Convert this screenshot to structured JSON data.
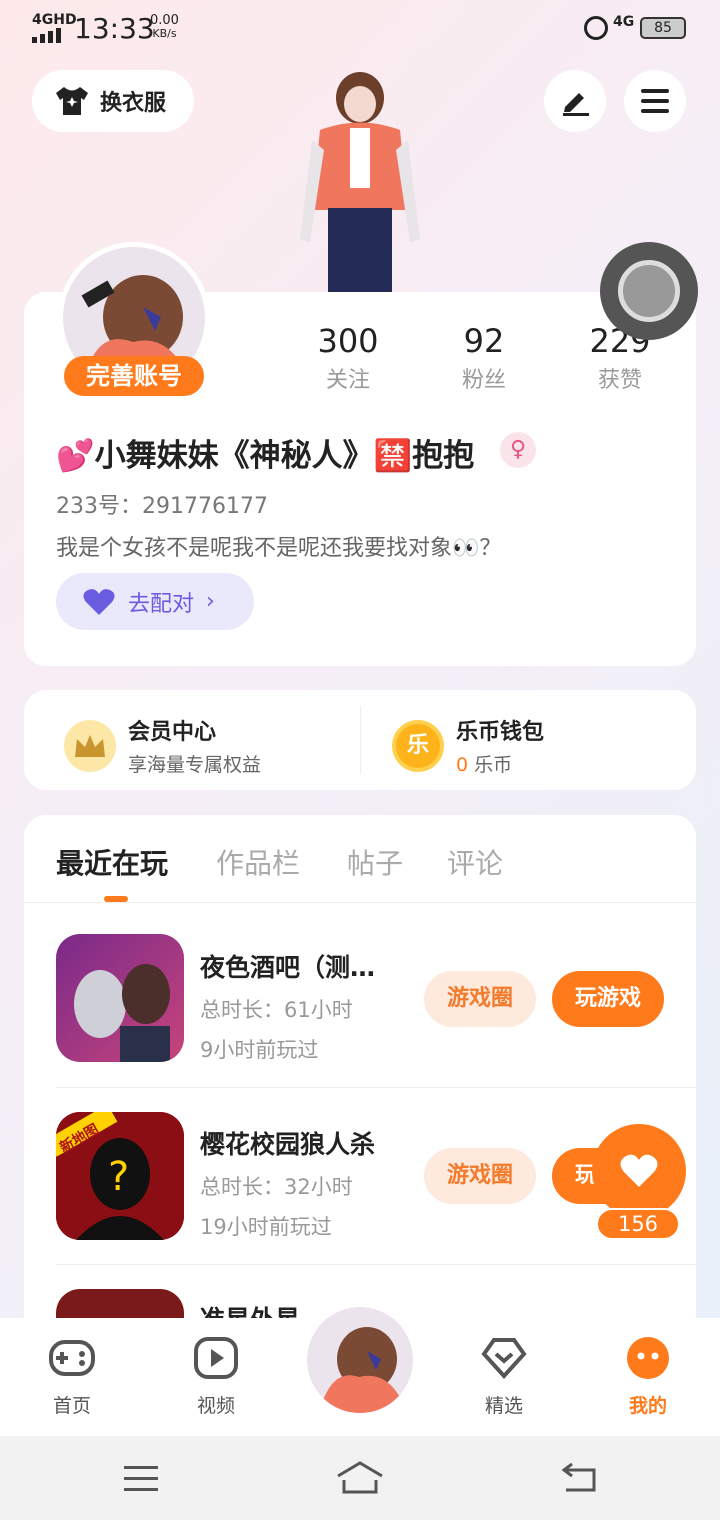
{
  "status_bar": {
    "network": "4GHD",
    "time": "13:33",
    "speed_value": "0.00",
    "speed_unit": "KB/s",
    "network_right": "4G",
    "battery": "85"
  },
  "header": {
    "outfit_label": "换衣服"
  },
  "profile": {
    "complete_label": "完善账号",
    "stats": [
      {
        "value": "300",
        "label": "关注"
      },
      {
        "value": "92",
        "label": "粉丝"
      },
      {
        "value": "229",
        "label": "获赞"
      }
    ],
    "nickname": "💕小舞妹妹《神秘人》🈲抱抱",
    "gender_symbol": "♀",
    "uid": "233号：291776177",
    "bio": "我是个女孩不是呢我不是呢还我要找对象👀？",
    "match_label": "去配对"
  },
  "member": {
    "vip_title": "会员中心",
    "vip_sub": "享海量专属权益",
    "wallet_title": "乐币钱包",
    "wallet_amount": "0",
    "wallet_unit": "乐币",
    "coin_char": "乐"
  },
  "tabs": [
    "最近在玩",
    "作品栏",
    "帖子",
    "评论"
  ],
  "games": [
    {
      "title": "夜色酒吧（测…",
      "duration": "总时长：61小时",
      "last_played": "9小时前玩过",
      "circle_label": "游戏圈",
      "play_label": "玩游戏"
    },
    {
      "title": "樱花校园狼人杀",
      "duration": "总时长：32小时",
      "last_played": "19小时前玩过",
      "circle_label": "游戏圈",
      "play_label": "玩游戏",
      "badge": "新地图"
    },
    {
      "title": "准星外星",
      "duration": "",
      "last_played": ""
    }
  ],
  "like_count": "156",
  "bottom_nav": [
    {
      "label": "首页",
      "icon": "gamepad-icon"
    },
    {
      "label": "视频",
      "icon": "video-icon"
    },
    {
      "label": "精选",
      "icon": "featured-icon"
    },
    {
      "label": "我的",
      "icon": "profile-icon"
    }
  ],
  "colors": {
    "accent": "#ff7a1a",
    "match": "#6a5ce0"
  }
}
